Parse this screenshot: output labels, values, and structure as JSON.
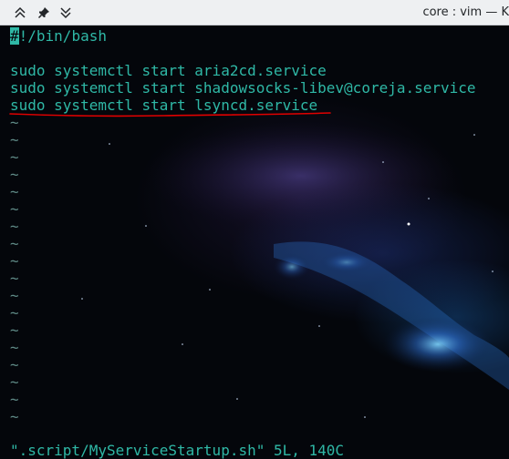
{
  "window": {
    "title": "core : vim — K",
    "buttons": [
      {
        "name": "keep-above",
        "icon": "double-chevron-up-icon"
      },
      {
        "name": "pin",
        "icon": "pin-icon"
      },
      {
        "name": "shade",
        "icon": "double-chevron-down-icon"
      }
    ]
  },
  "editor": {
    "lines": [
      {
        "cursor_char": "#",
        "rest": "!/bin/bash"
      },
      {
        "text": ""
      },
      {
        "text": "sudo systemctl start aria2cd.service"
      },
      {
        "text": "sudo systemctl start shadowsocks-libev@coreja.service"
      },
      {
        "text": "sudo systemctl start lsyncd.service"
      }
    ],
    "tilde": "~",
    "status": "\".script/MyServiceStartup.sh\" 5L, 140C"
  },
  "colors": {
    "text": "#2fb8a6",
    "annotation": "#e00000",
    "titlebar": "#eef0f2"
  }
}
